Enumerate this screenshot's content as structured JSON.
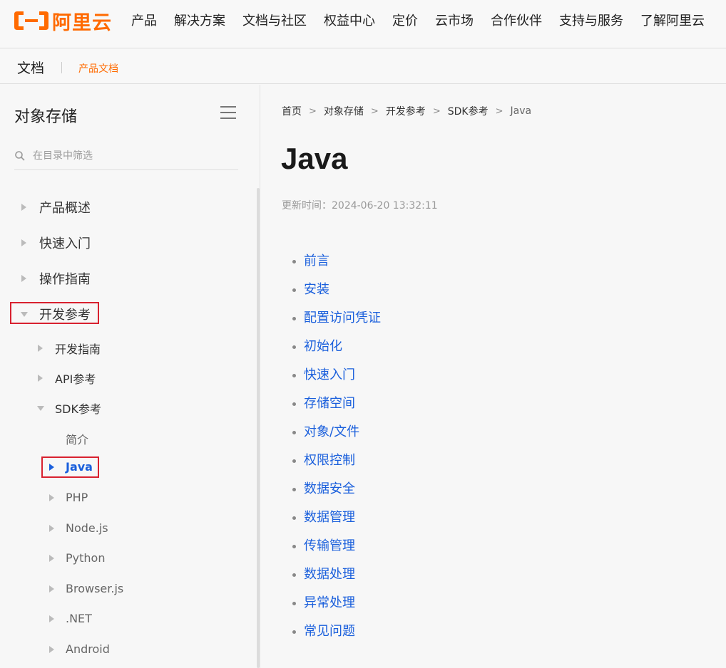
{
  "brand": {
    "logo_text": "阿里云",
    "accent": "#ff6a00"
  },
  "nav": {
    "items": [
      "产品",
      "解决方案",
      "文档与社区",
      "权益中心",
      "定价",
      "云市场",
      "合作伙伴",
      "支持与服务",
      "了解阿里云"
    ]
  },
  "subbar": {
    "title": "文档",
    "link": "产品文档"
  },
  "sidebar": {
    "title": "对象存储",
    "search_placeholder": "在目录中筛选",
    "items": [
      {
        "label": "产品概述",
        "level": 1,
        "state": "collapsed"
      },
      {
        "label": "快速入门",
        "level": 1,
        "state": "collapsed"
      },
      {
        "label": "操作指南",
        "level": 1,
        "state": "collapsed"
      },
      {
        "label": "开发参考",
        "level": 1,
        "state": "expanded",
        "highlighted": true
      },
      {
        "label": "开发指南",
        "level": 2,
        "state": "collapsed"
      },
      {
        "label": "API参考",
        "level": 2,
        "state": "collapsed"
      },
      {
        "label": "SDK参考",
        "level": 2,
        "state": "expanded"
      },
      {
        "label": "简介",
        "level": 3,
        "state": "leaf"
      },
      {
        "label": "Java",
        "level": 3,
        "state": "active",
        "highlighted": true
      },
      {
        "label": "PHP",
        "level": 3,
        "state": "collapsed"
      },
      {
        "label": "Node.js",
        "level": 3,
        "state": "collapsed"
      },
      {
        "label": "Python",
        "level": 3,
        "state": "collapsed"
      },
      {
        "label": "Browser.js",
        "level": 3,
        "state": "collapsed"
      },
      {
        "label": ".NET",
        "level": 3,
        "state": "collapsed"
      },
      {
        "label": "Android",
        "level": 3,
        "state": "collapsed"
      }
    ]
  },
  "main": {
    "breadcrumb": [
      "首页",
      "对象存储",
      "开发参考",
      "SDK参考",
      "Java"
    ],
    "title": "Java",
    "updated": "更新时间：2024-06-20 13:32:11",
    "toc": [
      "前言",
      "安装",
      "配置访问凭证",
      "初始化",
      "快速入门",
      "存储空间",
      "对象/文件",
      "权限控制",
      "数据安全",
      "数据管理",
      "传输管理",
      "数据处理",
      "异常处理",
      "常见问题"
    ]
  },
  "colors": {
    "link": "#1a5fdc",
    "highlight_box": "#d8212f"
  }
}
